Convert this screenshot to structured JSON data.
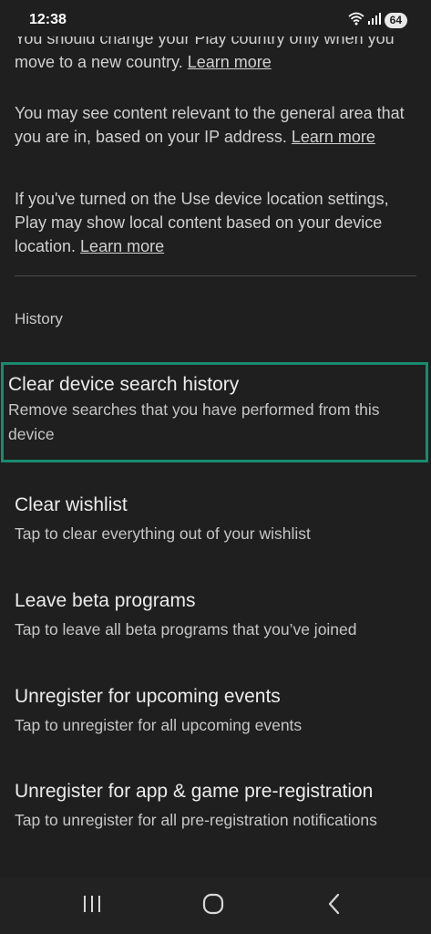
{
  "status_bar": {
    "time": "12:38",
    "battery": "64"
  },
  "location_info": {
    "para1_text": "You should change your Play country only when you move to a new country. ",
    "para1_link": "Learn more",
    "para2_text": "You may see content relevant to the general area that you are in, based on your IP address. ",
    "para2_link": "Learn more",
    "para3_text": "If you've turned on the Use device location settings, Play may show local content based on your device location. ",
    "para3_link": "Learn more"
  },
  "history": {
    "header": "History",
    "items": [
      {
        "title": "Clear device search history",
        "subtitle": "Remove searches that you have performed from this device"
      },
      {
        "title": "Clear wishlist",
        "subtitle": "Tap to clear everything out of your wishlist"
      },
      {
        "title": "Leave beta programs",
        "subtitle": "Tap to leave all beta programs that you’ve joined"
      },
      {
        "title": "Unregister for upcoming events",
        "subtitle": "Tap to unregister for all upcoming events"
      },
      {
        "title": "Unregister for app & game pre-registration",
        "subtitle": "Tap to unregister for all pre-registration notifications"
      }
    ]
  },
  "colors": {
    "background": "#1f1f1f",
    "selection_border": "#1a8a6e"
  },
  "nav_icons": [
    "recents-icon",
    "home-icon",
    "back-icon"
  ]
}
